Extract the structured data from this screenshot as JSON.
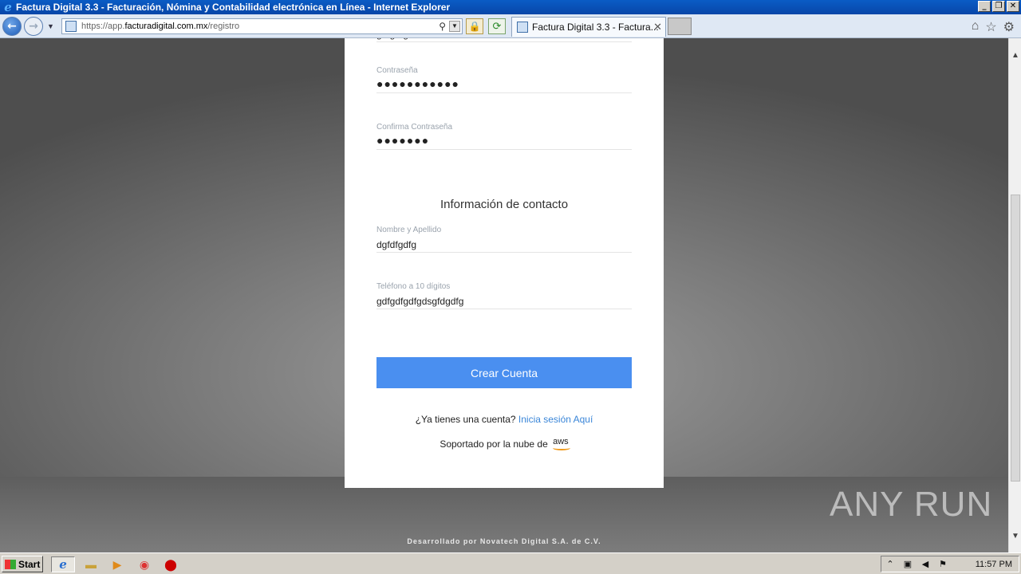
{
  "window": {
    "title": "Factura Digital 3.3 - Facturación, Nómina y Contabilidad electrónica en Línea - Internet Explorer"
  },
  "browser": {
    "url_prefix": "https://app.",
    "url_host": "facturadigital.com.mx",
    "url_path": "/registro",
    "tab_title": "Factura Digital 3.3 - Factura..."
  },
  "form": {
    "top_field_value": "gfdgdfgd",
    "password": {
      "label": "Contraseña",
      "value": "●●●●●●●●●●●"
    },
    "confirm_password": {
      "label": "Confirma Contraseña",
      "value": "●●●●●●●"
    },
    "section_title": "Información de contacto",
    "name": {
      "label": "Nombre y Apellido",
      "value": "dgfdfgdfg"
    },
    "phone": {
      "label": "Teléfono a 10 dígitos",
      "value": "gdfgdfgdfgdsgfdgdfg"
    },
    "submit_label": "Crear Cuenta",
    "login_prompt": "¿Ya tienes una cuenta?",
    "login_link": "Inicia sesión Aquí",
    "supported_by": "Soportado por la nube de",
    "aws_logo": "aws"
  },
  "footer": {
    "text": "Desarrollado por Novatech Digital S.A. de C.V."
  },
  "watermark": {
    "text": "ANY RUN"
  },
  "taskbar": {
    "start_label": "Start",
    "clock": "11:57 PM"
  }
}
